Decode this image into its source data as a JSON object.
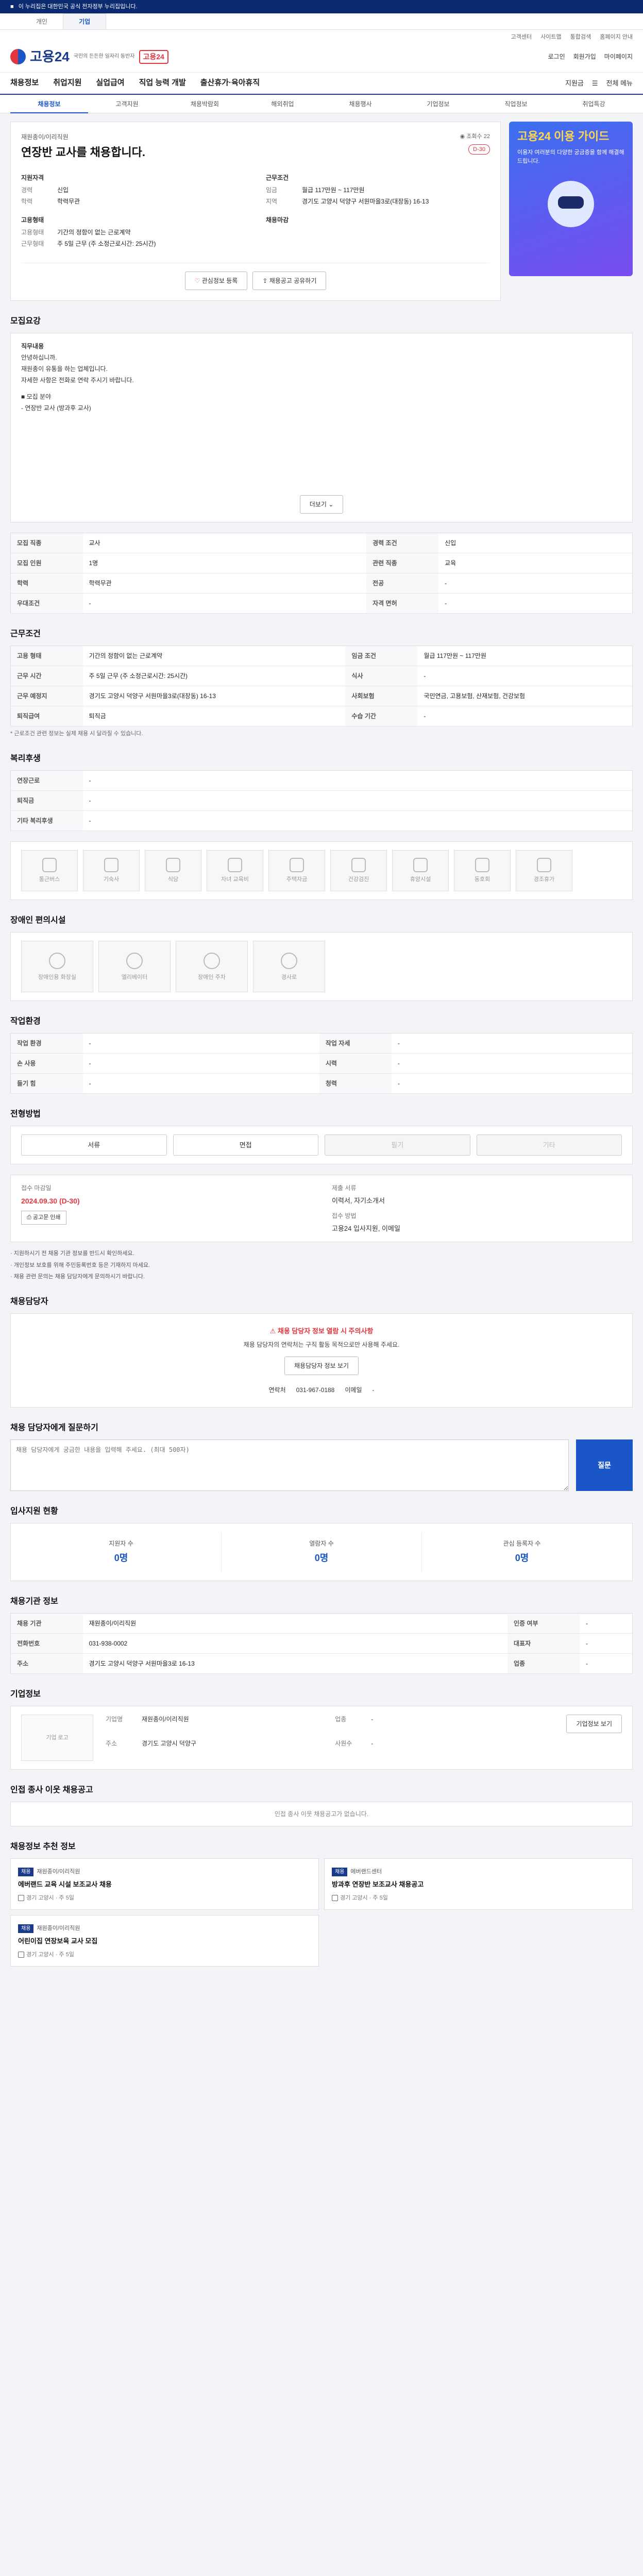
{
  "gov_banner": "이 누리집은 대한민국 공식 전자정부 누리집입니다.",
  "site_tabs": [
    "개인",
    "기업"
  ],
  "top_links": [
    "고객센터",
    "사이트맵",
    "통합검색",
    "홈페이지 안내"
  ],
  "logo": {
    "name": "고용24",
    "sub": "국민의 든든한 일자리 동반자",
    "badge": "고용24"
  },
  "user_links": [
    "로그인",
    "회원가입",
    "마이페이지"
  ],
  "gnb": [
    "채용정보",
    "취업지원",
    "실업급여",
    "직업 능력 개발",
    "출산휴가·육아휴직"
  ],
  "gnb_right": [
    "지원금",
    "전체 메뉴"
  ],
  "lnb": [
    "채용정보",
    "고객지원",
    "채용박람회",
    "해외취업",
    "채용행사",
    "기업정보",
    "직업정보",
    "취업특강"
  ],
  "summary": {
    "company": "재원종이/이리직원",
    "title": "연장반 교사를 채용합니다.",
    "views_label": "조회수",
    "views": "22",
    "dday": "D-30",
    "left_heading": "지원자격",
    "right_heading": "근무조건",
    "left": [
      {
        "k": "경력",
        "v": "신입"
      },
      {
        "k": "학력",
        "v": "학력무관"
      }
    ],
    "right": [
      {
        "k": "임금",
        "v": "월급 117만원 ~ 117만원"
      },
      {
        "k": "지역",
        "v": "경기도 고양시 덕양구 서원마을3로(대장동) 16-13"
      }
    ],
    "left_heading2": "고용형태",
    "left2": [
      {
        "k": "고용형태",
        "v": "기간의 정함이 없는 근로계약"
      },
      {
        "k": "근무형태",
        "v": "주 5일 근무 (주 소정근로시간: 25시간)"
      }
    ],
    "right_heading2": "채용마감",
    "btn_scrap": "관심정보 등록",
    "btn_share": "채용공고 공유하기"
  },
  "ad": {
    "title": "고용24 이용 가이드",
    "text": "이용자 여러분의 다양한 궁금증을 함께 해결해 드립니다."
  },
  "sections": {
    "desc": "직무내용",
    "recruit": "모집요강",
    "work": "근무조건",
    "benefit": "복리후생",
    "disability": "장애인 편의시설",
    "env": "작업환경",
    "method": "전형방법",
    "apply": "채용담당자",
    "inquiry": "채용 담당자에게 질문하기",
    "stats": "입사지원 현황",
    "company_info": "채용기관 정보",
    "company": "기업정보",
    "similar": "인접 종사 이웃 채용공고",
    "recommend": "채용정보 추천 정보"
  },
  "desc": {
    "heading": "직무내용",
    "lines": [
      "안녕하십니까.",
      "재원종이 유통을 하는 업체입니다.",
      "자세한 사항은 전화로 연락 주시기 바랍니다.",
      "■ 모집 분야",
      "- 연장반 교사 (방과후 교사)"
    ],
    "more": "더보기"
  },
  "recruit_rows": [
    [
      "모집 직종",
      "교사",
      "경력 조건",
      "신입"
    ],
    [
      "모집 인원",
      "1명",
      "관련 직종",
      "교육"
    ],
    [
      "학력",
      "학력무관",
      "전공",
      "-"
    ],
    [
      "우대조건",
      "-",
      "자격 면허",
      "-"
    ]
  ],
  "work_rows": [
    [
      "고용 형태",
      "기간의 정함이 없는 근로계약",
      "임금 조건",
      "월급 117만원 ~ 117만원"
    ],
    [
      "근무 시간",
      "주 5일 근무 (주 소정근로시간: 25시간)",
      "식사",
      "-"
    ],
    [
      "근무 예정지",
      "경기도 고양시 덕양구 서원마을3로(대장동) 16-13",
      "사회보험",
      "국민연금, 고용보험, 산재보험, 건강보험"
    ],
    [
      "퇴직급여",
      "퇴직금",
      "수습 기간",
      "-"
    ]
  ],
  "work_note": "* 근로조건 관련 정보는 실제 채용 시 달라질 수 있습니다.",
  "benefit_rows": [
    [
      "연장근로",
      "-"
    ],
    [
      "퇴직금",
      "-"
    ],
    [
      "기타 복리후생",
      "-"
    ]
  ],
  "welfare": [
    "통근버스",
    "기숙사",
    "식당",
    "자녀 교육비",
    "주택자금",
    "건강검진",
    "휴양시설",
    "동호회",
    "경조휴가",
    "-"
  ],
  "disability": [
    "장애인용 화장실",
    "엘리베이터",
    "장애인 주차",
    "경사로"
  ],
  "env_rows": [
    [
      "작업 환경",
      "-",
      "작업 자세",
      "-"
    ],
    [
      "손 사용",
      "-",
      "시력",
      "-"
    ],
    [
      "들기 힘",
      "-",
      "청력",
      "-"
    ]
  ],
  "method": {
    "buttons": [
      "서류",
      "면접",
      "필기",
      "기타"
    ],
    "deadline_label": "접수 마감일",
    "deadline": "2024.09.30 (D-30)",
    "doc_label": "제출 서류",
    "doc": "이력서, 자기소개서",
    "way_label": "접수 방법",
    "way": "고용24 입사지원, 이메일",
    "print_btn": "공고문 인쇄",
    "bullets": [
      "· 지원하시기 전 채용 기관 정보를 반드시 확인하세요.",
      "· 개인정보 보호를 위해 주민등록번호 등은 기재하지 마세요.",
      "· 채용 관련 문의는 채용 담당자에게 문의하시기 바랍니다."
    ]
  },
  "contact": {
    "warn": "채용 담당자 정보 열람 시 주의사항",
    "text": "채용 담당자의 연락처는 구직 활동 목적으로만 사용해 주세요.",
    "btn": "채용담당자 정보 보기",
    "phone_label": "연락처",
    "phone": "031-967-0188",
    "email_label": "이메일",
    "email": "-"
  },
  "inquiry": {
    "placeholder": "채용 담당자에게 궁금한 내용을 입력해 주세요. (최대 500자)",
    "btn": "질문"
  },
  "stats": [
    {
      "label": "지원자 수",
      "value": "0명"
    },
    {
      "label": "열람자 수",
      "value": "0명"
    },
    {
      "label": "관심 등록자 수",
      "value": "0명"
    }
  ],
  "company_info_rows": [
    [
      "채용 기관",
      "재원종이/이리직원",
      "인증 여부",
      "-"
    ],
    [
      "전화번호",
      "031-938-0002",
      "대표자",
      "-"
    ],
    [
      "주소",
      "경기도 고양시 덕양구 서원마을3로 16-13",
      "업종",
      "-"
    ]
  ],
  "company_box": {
    "logo": "기업 로고",
    "btn": "기업정보 보기",
    "rows": [
      {
        "k": "기업명",
        "v": "재원종이/이리직원"
      },
      {
        "k": "업종",
        "v": "-"
      },
      {
        "k": "주소",
        "v": "경기도 고양시 덕양구"
      },
      {
        "k": "사원수",
        "v": "-"
      }
    ]
  },
  "similar_empty": "인접 종사 이웃 채용공고가 없습니다.",
  "recommend": [
    {
      "tag": "채용",
      "company": "재원종이/이리직원",
      "title": "에버랜드 교육 시설 보조교사 채용",
      "meta": "경기 고양시 · 주 5일"
    },
    {
      "tag": "채용",
      "company": "에버랜드센터",
      "title": "방과후 연장반 보조교사 채용공고",
      "meta": "경기 고양시 · 주 5일"
    },
    {
      "tag": "채용",
      "company": "재원종이/이리직원",
      "title": "어린이집 연장보육 교사 모집",
      "meta": "경기 고양시 · 주 5일"
    }
  ]
}
